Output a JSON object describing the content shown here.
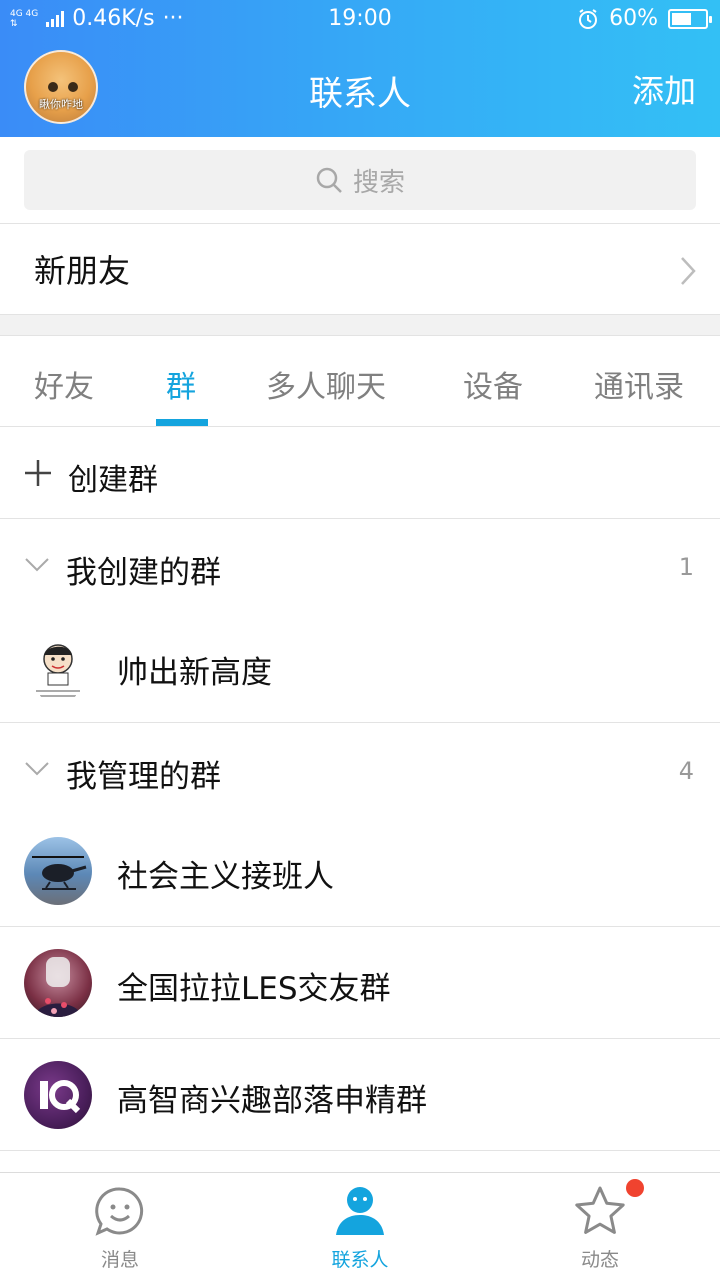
{
  "status_bar": {
    "network": "4G 4G",
    "speed": "0.46K/s",
    "more": "···",
    "time": "19:00",
    "battery": "60%",
    "battery_level": 0.6
  },
  "header": {
    "title": "联系人",
    "add_label": "添加",
    "avatar_caption": "瞅你咋地"
  },
  "search": {
    "placeholder": "搜索"
  },
  "new_friends": {
    "label": "新朋友"
  },
  "tabs": [
    {
      "label": "好友",
      "active": false
    },
    {
      "label": "群",
      "active": true
    },
    {
      "label": "多人聊天",
      "active": false
    },
    {
      "label": "设备",
      "active": false
    },
    {
      "label": "通讯录",
      "active": false
    }
  ],
  "create_group": {
    "label": "创建群"
  },
  "sections": [
    {
      "title": "我创建的群",
      "count": "1",
      "groups": [
        {
          "name": "帅出新高度"
        }
      ]
    },
    {
      "title": "我管理的群",
      "count": "4",
      "groups": [
        {
          "name": "社会主义接班人"
        },
        {
          "name": "全国拉拉LES交友群"
        },
        {
          "name": "高智商兴趣部落申精群"
        }
      ]
    }
  ],
  "bottom_nav": [
    {
      "label": "消息",
      "icon": "chat-bubble-icon",
      "active": false
    },
    {
      "label": "联系人",
      "icon": "person-icon",
      "active": true
    },
    {
      "label": "动态",
      "icon": "star-icon",
      "active": false,
      "badge": true
    }
  ],
  "colors": {
    "accent": "#14a4de",
    "header_start": "#3a8cf7",
    "header_end": "#33c0f5",
    "badge": "#f0432f"
  }
}
